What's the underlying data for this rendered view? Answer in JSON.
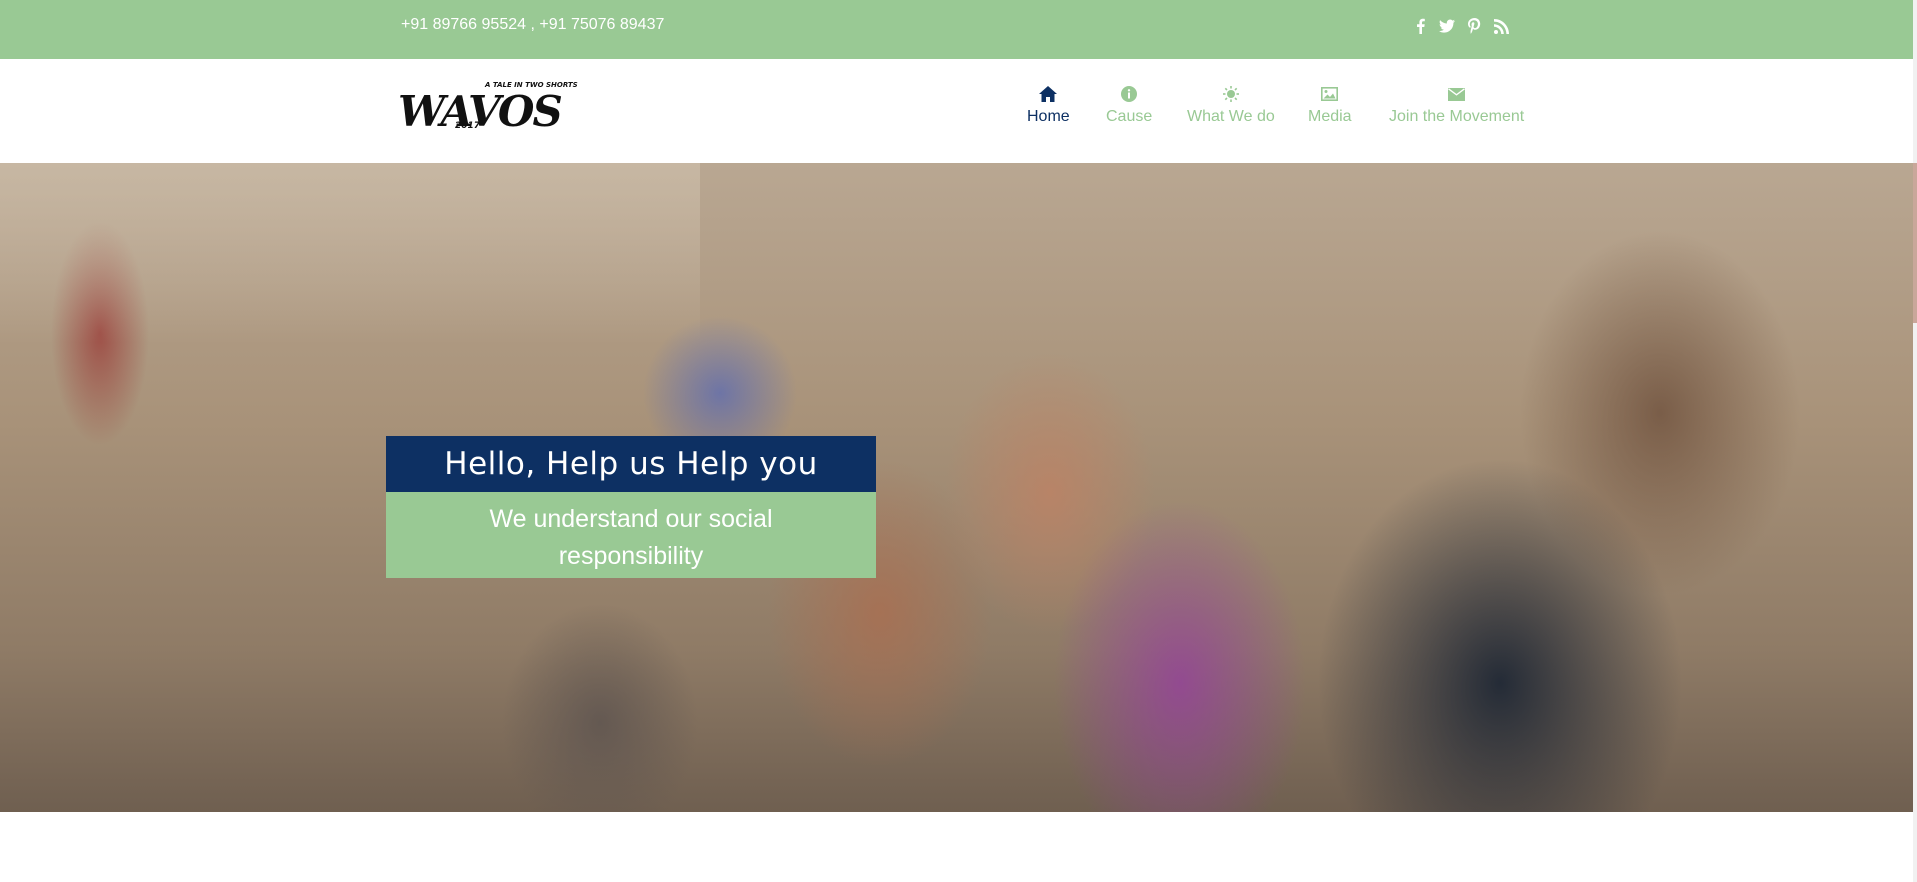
{
  "topbar": {
    "phones": "+91 89766 95524 , +91 75076 89437",
    "social": [
      {
        "icon": "facebook-icon"
      },
      {
        "icon": "twitter-icon"
      },
      {
        "icon": "pinterest-icon"
      },
      {
        "icon": "rss-icon"
      }
    ],
    "bg_color": "#99c994"
  },
  "logo": {
    "word": "WAVOS",
    "tagline": "A TALE IN TWO SHORTS",
    "year": "2017"
  },
  "nav": {
    "items": [
      {
        "label": "Home",
        "icon": "home-icon",
        "active": true
      },
      {
        "label": "Cause",
        "icon": "info-icon",
        "active": false
      },
      {
        "label": "What We do",
        "icon": "sun-icon",
        "active": false
      },
      {
        "label": "Media",
        "icon": "image-icon",
        "active": false
      },
      {
        "label": "Join the Movement",
        "icon": "envelope-icon",
        "active": false
      }
    ],
    "active_color": "#0d3063",
    "inactive_color": "#99c994"
  },
  "hero": {
    "title": "Hello, Help us Help you",
    "subtitle": "We understand our social responsibility",
    "title_bg": "#0d3063",
    "subtitle_bg": "#99c994"
  }
}
